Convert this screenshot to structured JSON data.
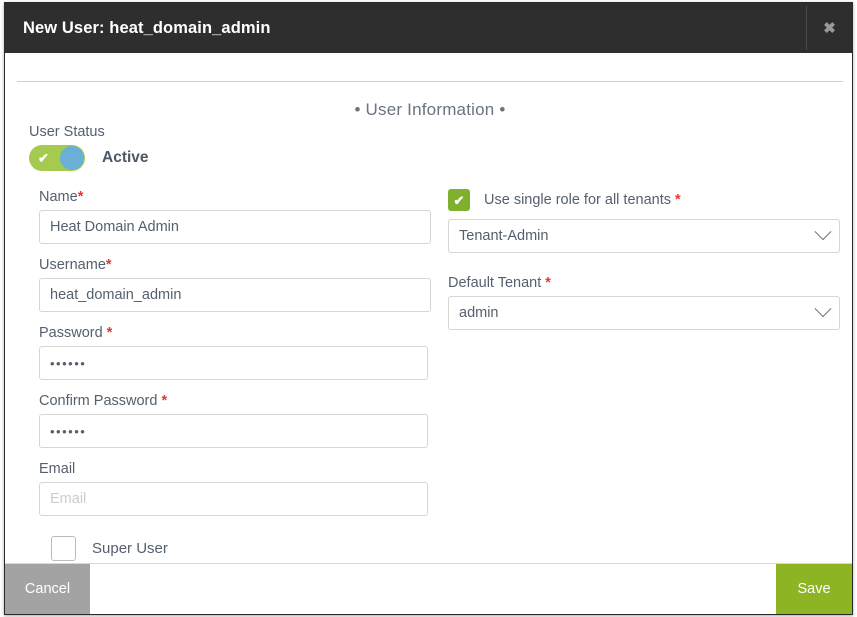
{
  "titlebar": {
    "title": "New User: heat_domain_admin",
    "close_icon": "close-icon",
    "close_glyph": "✖"
  },
  "section": {
    "heading": "• User Information •"
  },
  "user_status": {
    "label": "User Status",
    "value": "Active",
    "toggle_on": true,
    "toggle_check_glyph": "✔",
    "track_color": "#a4ca4f",
    "knob_color": "#6aafd6"
  },
  "left_column": {
    "name": {
      "label": "Name",
      "required_mark": "*",
      "value": "Heat Domain Admin",
      "placeholder": ""
    },
    "username": {
      "label": "Username",
      "required_mark": "*",
      "value": "heat_domain_admin",
      "placeholder": ""
    },
    "password": {
      "label": "Password",
      "required_mark": "*",
      "value": "••••••",
      "placeholder": ""
    },
    "confirm_password": {
      "label": "Confirm Password",
      "required_mark": "*",
      "value": "••••••",
      "placeholder": ""
    },
    "email": {
      "label": "Email",
      "value": "",
      "placeholder": "Email"
    },
    "super_user": {
      "label": "Super User",
      "checked": false
    }
  },
  "right_column": {
    "single_role": {
      "label": "Use single role for all tenants",
      "required_mark": "*",
      "checked": true,
      "check_glyph": "✔",
      "check_color": "#7fb02e"
    },
    "role_select": {
      "value": "Tenant-Admin",
      "chevron_icon": "chevron-down-icon"
    },
    "default_tenant": {
      "label": "Default Tenant",
      "required_mark": "*",
      "value": "admin",
      "chevron_icon": "chevron-down-icon"
    }
  },
  "footer": {
    "cancel_label": "Cancel",
    "save_label": "Save",
    "cancel_color": "#a3a3a3",
    "save_color": "#8cb423"
  }
}
